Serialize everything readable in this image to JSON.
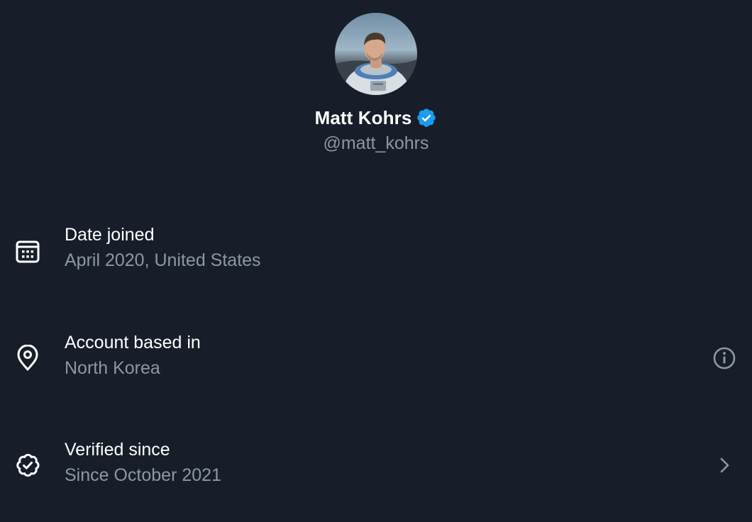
{
  "profile": {
    "display_name": "Matt Kohrs",
    "handle": "@matt_kohrs",
    "verified": true,
    "avatar_icon": "astronaut-avatar"
  },
  "about": {
    "date_joined": {
      "title": "Date joined",
      "value": "April 2020, United States",
      "icon": "calendar-icon"
    },
    "account_based_in": {
      "title": "Account based in",
      "value": "North Korea",
      "icon": "location-pin-icon",
      "trailing_icon": "info-icon"
    },
    "verified_since": {
      "title": "Verified since",
      "value": "Since October 2021",
      "icon": "verified-badge-icon",
      "trailing_icon": "chevron-right-icon"
    }
  },
  "colors": {
    "background": "#171e29",
    "primary_text": "#ffffff",
    "secondary_text": "#8b98a5",
    "verified_blue": "#1d9bf0"
  }
}
